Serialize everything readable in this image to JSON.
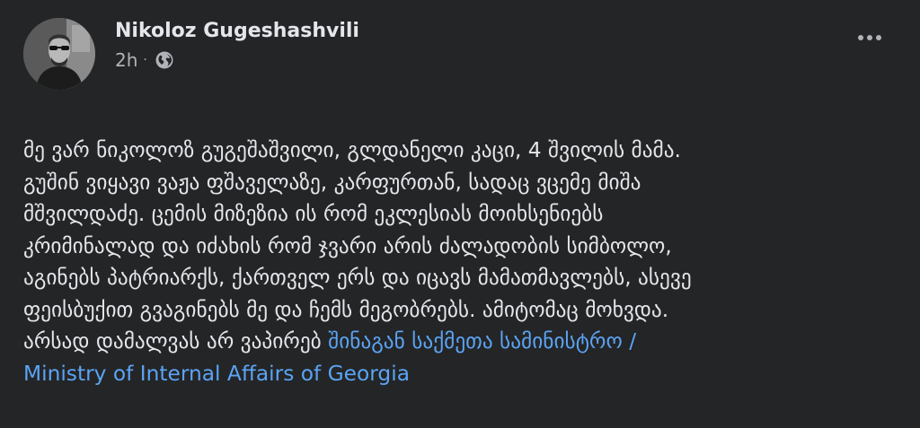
{
  "post": {
    "author": "Nikoloz Gugeshashvili",
    "timestamp": "2h",
    "separator": "·",
    "audience_icon": "globe-icon",
    "more_icon": "more-options-icon",
    "body_text": "მე ვარ ნიკოლოზ გუგეშაშვილი, გლდანელი კაცი, 4 შვილის მამა.\nგუშინ ვიყავი ვაჟა ფშაველაზე, კარფურთან, სადაც ვცემე მიშა\nმშვილდაძე. ცემის მიზეზია ის რომ ეკლესიას მოიხსენიებს\nკრიმინალად და იძახის რომ ჯვარი არის ძალადობის სიმბოლო,\nაგინებს პატრიარქს, ქართველ ერს და იცავს მამათმავლებს, ასევე\nფეისბუქით გვაგინებს მე და ჩემს მეგობრებს. ამიტომაც მოხვდა.\nარსად დამალვას არ ვაპირებ ",
    "mention": "შინაგან საქმეთა სამინისტრო /\nMinistry of Internal Affairs of Georgia",
    "colors": {
      "background": "#242526",
      "text": "#e4e6eb",
      "secondary_text": "#b0b3b8",
      "link": "#5ba4f5"
    }
  }
}
